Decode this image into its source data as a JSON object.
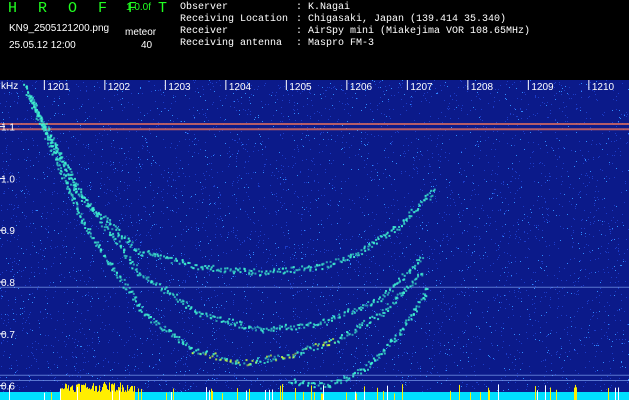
{
  "header": {
    "brand": "H R O F F T",
    "version": "1.0.0f",
    "filename": "KN9_2505121200.png",
    "meteor_label": "meteor",
    "datetime": "25.05.12 12:00",
    "meteor_count": "40",
    "observer_label": "Observer",
    "observer_value": ": K.Nagai",
    "location_label": "Receiving Location",
    "location_value": ": Chigasaki, Japan (139.414 35.340)",
    "receiver_label": "Receiver",
    "receiver_value": ": AirSpy mini (Miakejima VOR 108.65MHz)",
    "antenna_label": "Receiving antenna",
    "antenna_value": ": Maspro FM-3"
  },
  "chart_data": {
    "type": "heatmap",
    "ylabel": "kHz",
    "x_ticks": [
      "1201",
      "1202",
      "1203",
      "1204",
      "1205",
      "1206",
      "1207",
      "1208",
      "1209",
      "1210"
    ],
    "y_ticks": [
      "1.1",
      "1.0",
      "0.9",
      "0.8",
      "0.7",
      "0.6"
    ],
    "ylim": [
      0.58,
      1.19
    ],
    "colors": {
      "background": "#0b1a8a",
      "noise_low": "#1b3cc8",
      "noise_mid": "#2e8bff",
      "echo": "#3ff0d0",
      "echo_peak": "#c8ff40",
      "band_line": "#c86464",
      "baseline": "#00e0ff",
      "baseline_peak": "#ffee00"
    },
    "series": [
      {
        "x": [
          1200.6,
          1201.5,
          1202.5,
          1203.5,
          1204.5,
          1205.5,
          1206.2,
          1206.8,
          1207.4
        ],
        "y": [
          1.18,
          0.97,
          0.86,
          0.83,
          0.82,
          0.83,
          0.86,
          0.91,
          0.98
        ]
      },
      {
        "x": [
          1200.7,
          1201.5,
          1202.5,
          1203.5,
          1204.5,
          1205.5,
          1206.5,
          1207.2
        ],
        "y": [
          1.16,
          0.98,
          0.82,
          0.74,
          0.71,
          0.72,
          0.77,
          0.85
        ]
      },
      {
        "x": [
          1200.7,
          1201.6,
          1202.6,
          1203.4,
          1204.2,
          1205.0,
          1205.8,
          1206.5,
          1207.2
        ],
        "y": [
          1.16,
          0.91,
          0.74,
          0.67,
          0.645,
          0.66,
          0.69,
          0.74,
          0.82
        ]
      },
      {
        "x": [
          1205.0,
          1205.6,
          1206.2,
          1206.8,
          1207.3
        ],
        "y": [
          0.61,
          0.6,
          0.63,
          0.7,
          0.79
        ]
      }
    ],
    "horizontal_lines": [
      1.105,
      1.095,
      0.79,
      0.62,
      0.61
    ]
  }
}
